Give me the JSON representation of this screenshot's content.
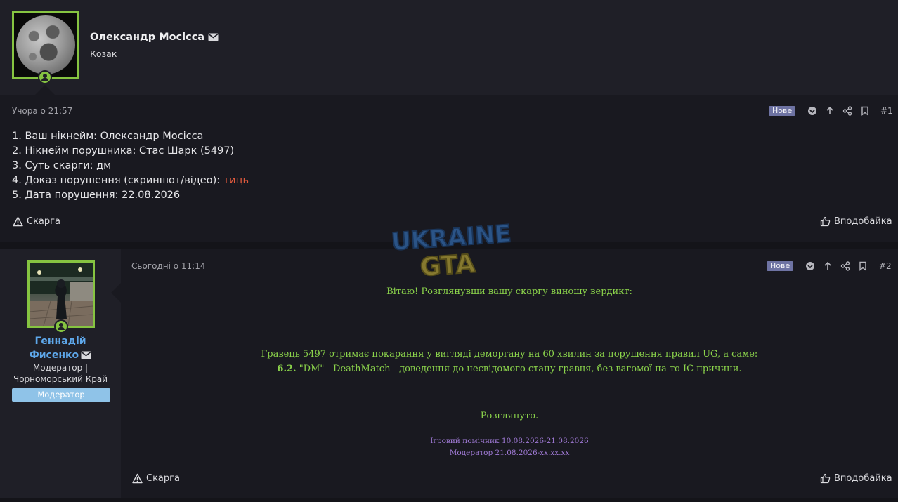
{
  "post1": {
    "author": "Олександр Мосісса",
    "role": "Козак",
    "time": "Учора о 21:57",
    "badge": "Нове",
    "post_number": "#1",
    "lines": [
      "1. Ваш нікнейм: Олександр Мосісса",
      "2. Нікнейм порушника: Стас Шарк (5497)",
      "3. Суть скарги: дм",
      "4. Доказ порушення (скриншот/відео): "
    ],
    "evidence_link": "тиць",
    "line5": "5. Дата порушення: 22.08.2026",
    "report_label": "Скарга",
    "like_label": "Вподобайка"
  },
  "watermark": {
    "line1": "UKRAINE",
    "line2": "GTA"
  },
  "post2": {
    "author_line1": "Геннадій",
    "author_line2": "Фисенко",
    "role_line1": "Модератор |",
    "role_line2": "Чорноморський Край",
    "banner": "Модератор",
    "time": "Сьогодні о 11:14",
    "badge": "Нове",
    "post_number": "#2",
    "greeting": "Вітаю! Розглянувши вашу скаргу виношу вердикт:",
    "verdict": "Гравець 5497 отримає покарання у вигляді деморгану на 60 хвилин за порушення правил UG, а саме:",
    "rule_num": "6.2.",
    "rule_text": " \"DM\" - DeathMatch - доведення до несвідомого стану гравця, без вагомої на то IC причини.",
    "status": "Розглянуто.",
    "sig_line1": "Ігровий помічник 10.08.2026-21.08.2026",
    "sig_line2": "Модератор 21.08.2026-xx.xx.xx",
    "report_label": "Скарга",
    "like_label": "Вподобайка"
  },
  "colors": {
    "online_green": "#86c441",
    "badge_new": "#6e73a3",
    "moderator_name": "#5ea7ea",
    "moderator_banner": "#8fc3e8",
    "verdict_green": "#8bd34b",
    "signature_purple": "#a07ad6",
    "link_red": "#e05a3d"
  }
}
